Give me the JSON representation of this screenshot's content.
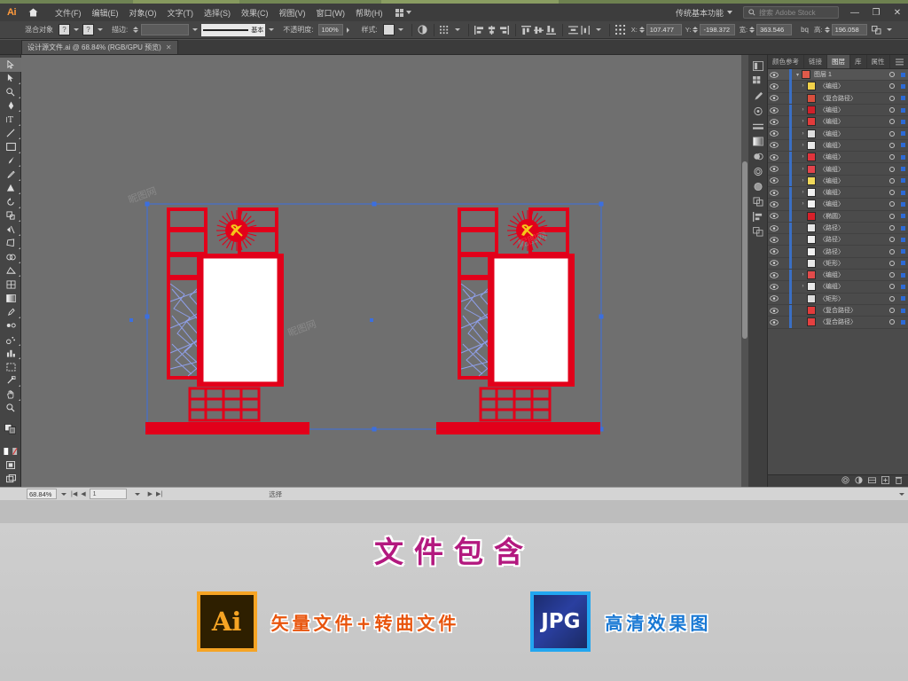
{
  "app": {
    "name": "Adobe Illustrator",
    "logo_text": "Ai",
    "workspace": "传统基本功能",
    "search_placeholder": "搜索 Adobe Stock"
  },
  "menubar": {
    "items": [
      {
        "label": "文件(F)"
      },
      {
        "label": "编辑(E)"
      },
      {
        "label": "对象(O)"
      },
      {
        "label": "文字(T)"
      },
      {
        "label": "选择(S)"
      },
      {
        "label": "效果(C)"
      },
      {
        "label": "视图(V)"
      },
      {
        "label": "窗口(W)"
      },
      {
        "label": "帮助(H)"
      }
    ],
    "window_buttons": {
      "minimize": "—",
      "restore": "❐",
      "close": "✕"
    }
  },
  "controlbar": {
    "object_label": "混合对象",
    "fill_swatch": "?",
    "stroke_swatch": "?",
    "stroke_label": "描边:",
    "stroke_weight": "",
    "stroke_profile": "基本",
    "opacity_label": "不透明度:",
    "opacity_value": "100%",
    "style_label": "样式:",
    "x_label": "X:",
    "x_value": "107.477",
    "y_label": "Y:",
    "y_value": "-198.372",
    "w_label": "宽:",
    "w_value": "363.546",
    "h_label": "高:",
    "h_value": "196.058",
    "link_label": "bq"
  },
  "document_tab": {
    "title": "设计源文件.ai @ 68.84% (RGB/GPU 预览)",
    "close": "✕"
  },
  "toolbar": {
    "tools": [
      {
        "name": "selection-tool",
        "glyph": "selection"
      },
      {
        "name": "direct-selection-tool",
        "glyph": "direct"
      },
      {
        "name": "magic-wand-tool",
        "glyph": "wand"
      },
      {
        "name": "pen-tool",
        "glyph": "pen"
      },
      {
        "name": "type-tool",
        "glyph": "T"
      },
      {
        "name": "line-segment-tool",
        "glyph": "line"
      },
      {
        "name": "rectangle-tool",
        "glyph": "rect"
      },
      {
        "name": "paintbrush-tool",
        "glyph": "brush"
      },
      {
        "name": "pencil-tool",
        "glyph": "pencil"
      },
      {
        "name": "shaper-tool",
        "glyph": "shaper"
      },
      {
        "name": "rotate-tool",
        "glyph": "rotate"
      },
      {
        "name": "scale-tool",
        "glyph": "scale"
      },
      {
        "name": "width-tool",
        "glyph": "width"
      },
      {
        "name": "free-transform-tool",
        "glyph": "transform"
      },
      {
        "name": "shape-builder-tool",
        "glyph": "shapebuilder"
      },
      {
        "name": "perspective-grid-tool",
        "glyph": "perspective"
      },
      {
        "name": "mesh-tool",
        "glyph": "mesh"
      },
      {
        "name": "gradient-tool",
        "glyph": "gradient"
      },
      {
        "name": "eyedropper-tool",
        "glyph": "eyedropper"
      },
      {
        "name": "blend-tool",
        "glyph": "blend"
      },
      {
        "name": "symbol-sprayer-tool",
        "glyph": "sprayer"
      },
      {
        "name": "column-graph-tool",
        "glyph": "graph"
      },
      {
        "name": "artboard-tool",
        "glyph": "artboard"
      },
      {
        "name": "slice-tool",
        "glyph": "slice"
      },
      {
        "name": "hand-tool",
        "glyph": "hand"
      },
      {
        "name": "zoom-tool",
        "glyph": "zoom"
      }
    ]
  },
  "panels": {
    "tabs": [
      {
        "label": "颜色参考",
        "active": false
      },
      {
        "label": "链接",
        "active": false
      },
      {
        "label": "图层",
        "active": true
      },
      {
        "label": "库",
        "active": false
      },
      {
        "label": "属性",
        "active": false
      }
    ],
    "layers": [
      {
        "name": "图层 1",
        "root": true,
        "expanded": true,
        "color": "#e05a4a",
        "selected": true
      },
      {
        "name": "〈编组〉",
        "arrow": true,
        "color": "#f2d14a"
      },
      {
        "name": "〈复合路径〉",
        "arrow": false,
        "color": "#d94f3d"
      },
      {
        "name": "〈编组〉",
        "arrow": true,
        "color": "#d0202a"
      },
      {
        "name": "〈编组〉",
        "arrow": true,
        "color": "#e23b3b"
      },
      {
        "name": "〈编组〉",
        "arrow": true,
        "color": "#dddddd"
      },
      {
        "name": "〈编组〉",
        "arrow": true,
        "color": "#e8e8e8"
      },
      {
        "name": "〈编组〉",
        "arrow": true,
        "color": "#e0343c"
      },
      {
        "name": "〈编组〉",
        "arrow": true,
        "color": "#e2444c"
      },
      {
        "name": "〈编组〉",
        "arrow": true,
        "color": "#f0d85a"
      },
      {
        "name": "〈编组〉",
        "arrow": true,
        "color": "#efefef"
      },
      {
        "name": "〈编组〉",
        "arrow": true,
        "color": "#f2f2f2"
      },
      {
        "name": "〈椭圆〉",
        "arrow": false,
        "color": "#d8202a"
      },
      {
        "name": "〈路径〉",
        "arrow": false,
        "color": "#e6e6e6"
      },
      {
        "name": "〈路径〉",
        "arrow": false,
        "color": "#ededed"
      },
      {
        "name": "〈路径〉",
        "arrow": false,
        "color": "#f0f0f0"
      },
      {
        "name": "〈矩形〉",
        "arrow": false,
        "color": "#e8e8e8"
      },
      {
        "name": "〈编组〉",
        "arrow": true,
        "color": "#e24b4b"
      },
      {
        "name": "〈编组〉",
        "arrow": true,
        "color": "#e9e9e9"
      },
      {
        "name": "〈矩形〉",
        "arrow": false,
        "color": "#dcdcdc"
      },
      {
        "name": "〈复合路径〉",
        "arrow": false,
        "color": "#e33b3b"
      },
      {
        "name": "〈复合路径〉",
        "arrow": false,
        "color": "#e54040"
      }
    ],
    "footer_icons": [
      "locate-object",
      "make-clipping-mask",
      "create-sublayer",
      "new-layer",
      "delete-layer"
    ]
  },
  "statusbar": {
    "zoom": "68.84%",
    "page": "1",
    "status": "选择"
  },
  "artwork": {
    "description": "中式党建宣传栏设计稿",
    "accent_red": "#e2001a",
    "lattice_blue": "#8f9fe8",
    "panel_white": "#ffffff",
    "emblem_gold": "#f5c518"
  },
  "promo": {
    "title": "文件包含",
    "items": [
      {
        "badge": "Ai",
        "label": "矢量文件+转曲文件",
        "badge_type": "ai"
      },
      {
        "badge": "JPG",
        "label": "高清效果图",
        "badge_type": "jpg"
      }
    ]
  }
}
